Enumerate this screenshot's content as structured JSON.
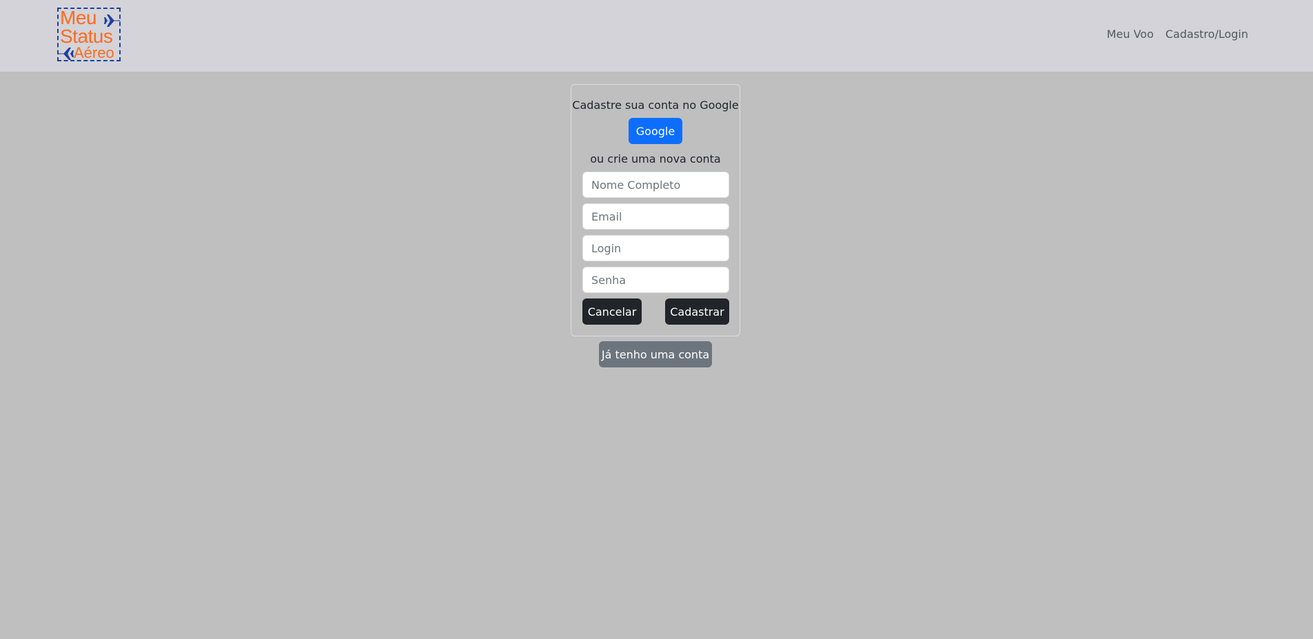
{
  "navbar": {
    "logo": {
      "line1": "Meu",
      "line2": "Status",
      "line3": "Aéreo"
    },
    "links": [
      "Meu Voo",
      "Cadastro/Login"
    ]
  },
  "signup_card": {
    "google_prompt": "Cadastre sua conta no Google",
    "google_button": "Google",
    "or_prompt": "ou crie uma nova conta",
    "fields": {
      "full_name_placeholder": "Nome Completo",
      "email_placeholder": "Email",
      "login_placeholder": "Login",
      "password_placeholder": "Senha"
    },
    "cancel_button": "Cancelar",
    "submit_button": "Cadastrar"
  },
  "have_account_button": "Já tenho uma conta",
  "colors": {
    "navbar_bg": "#d3d3d9",
    "page_bg": "#c0bfc0",
    "primary": "#0d6efd",
    "dark": "#212529",
    "secondary": "#6c757d",
    "logo_orange": "#ff6a1c",
    "logo_blue": "#1d3fa0"
  }
}
